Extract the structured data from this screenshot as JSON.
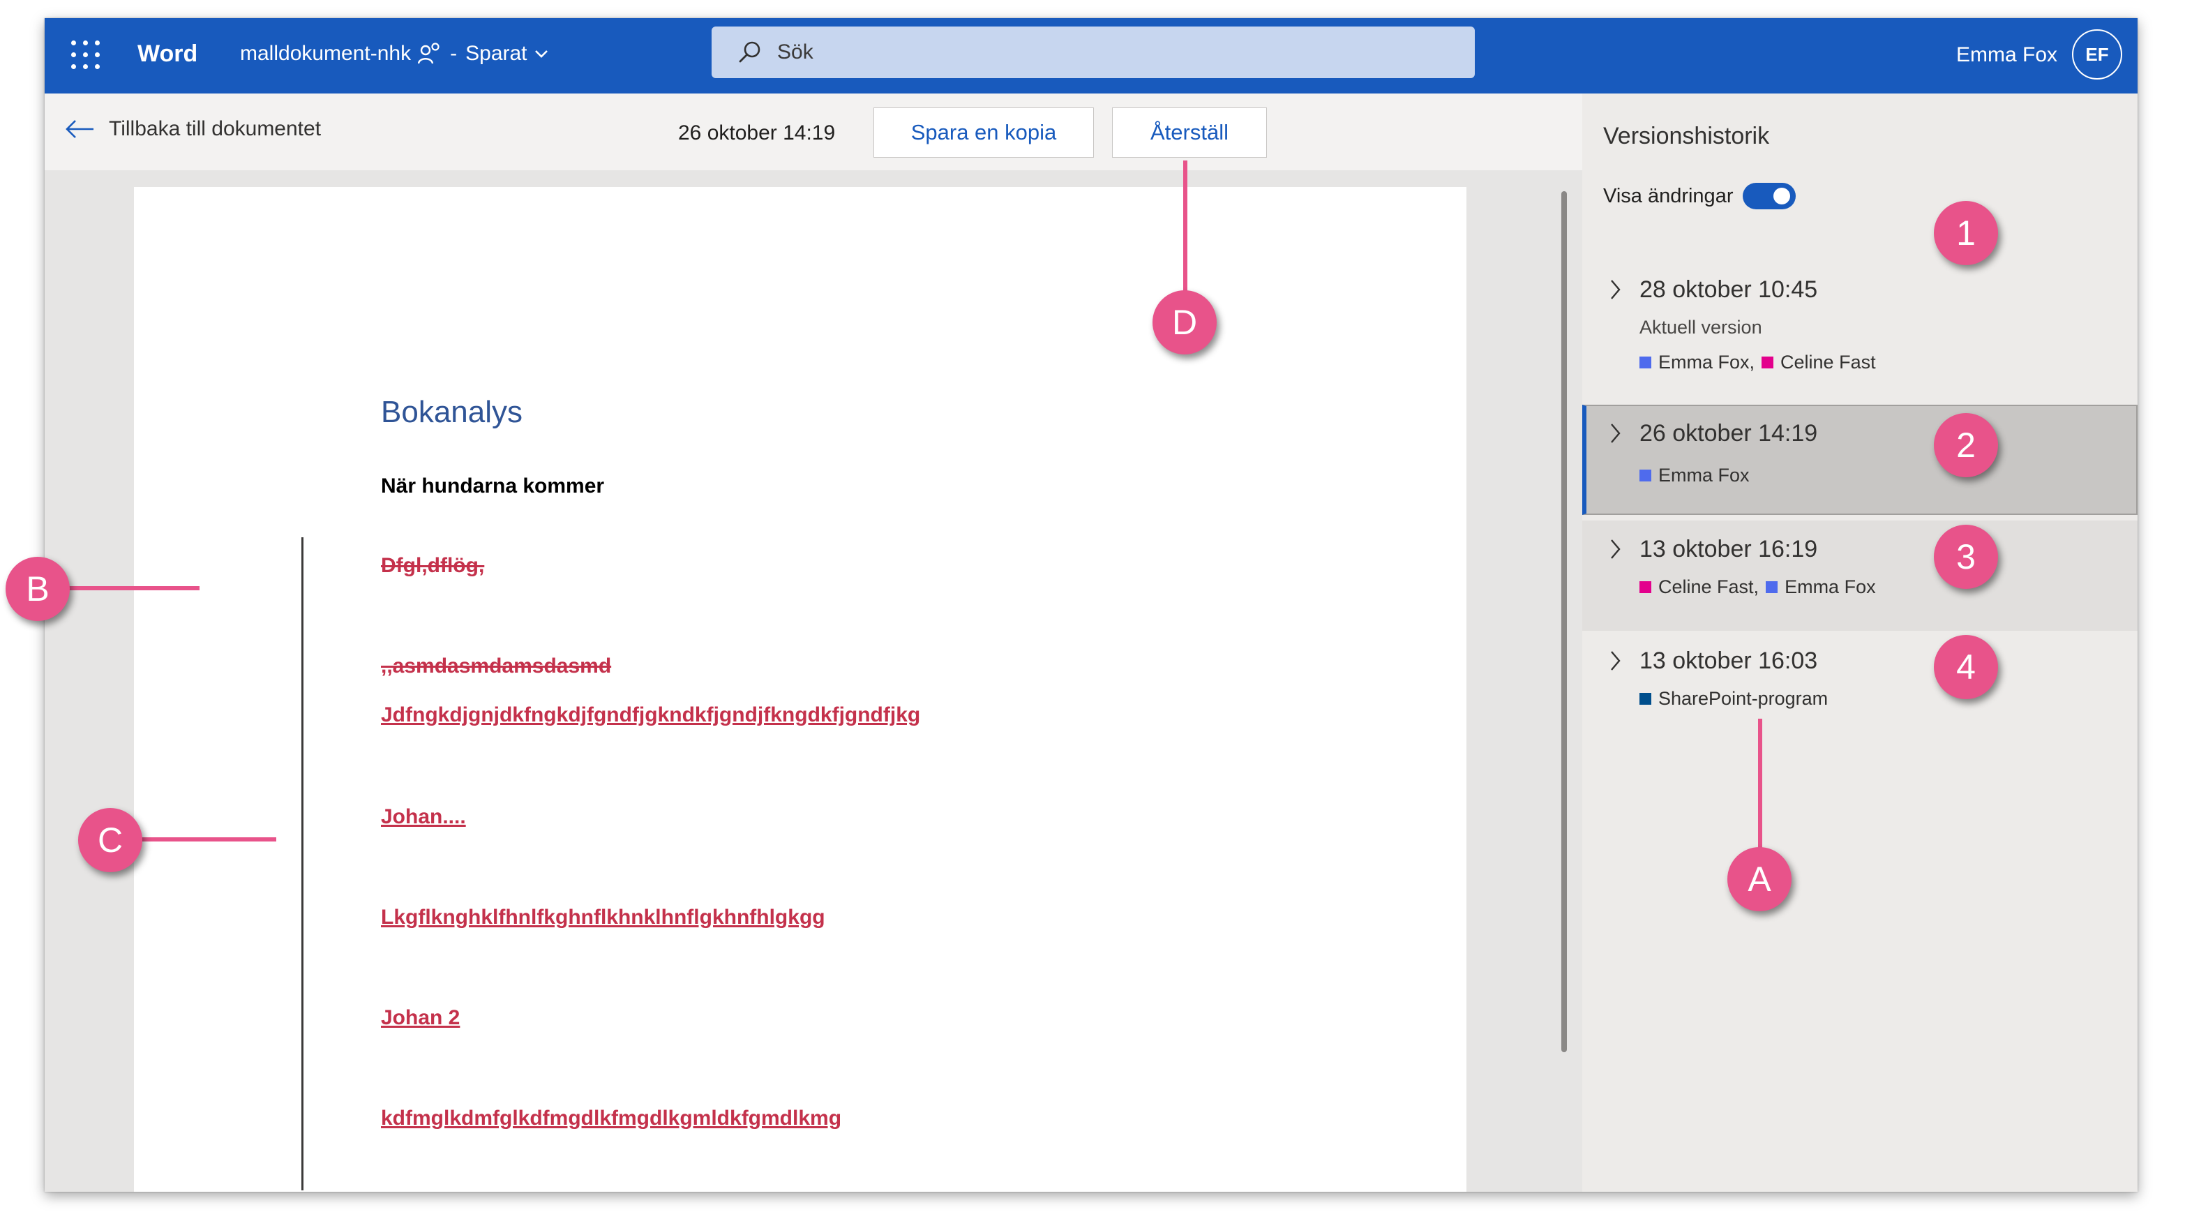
{
  "app": {
    "name": "Word",
    "doc_name": "malldokument-nhk",
    "separator": "-",
    "save_status": "Sparat"
  },
  "search": {
    "placeholder": "Sök"
  },
  "user": {
    "name": "Emma Fox",
    "initials": "EF"
  },
  "toolbar": {
    "back_label": "Tillbaka till dokumentet",
    "version_date": "26 oktober 14:19",
    "save_copy_label": "Spara en kopia",
    "restore_label": "Återställ"
  },
  "document": {
    "title": "Bokanalys",
    "subtitle": "När hundarna kommer",
    "lines": [
      {
        "text": "Dfgl,dflög,",
        "style": "deleted"
      },
      {
        "text": ",,asmdasmdamsdasmd",
        "style": "deleted"
      },
      {
        "text": "Jdfngkdjgnjdkfngkdjfgndfjgkndkfjgndjfkngdkfjgndfjkg",
        "style": "inserted"
      },
      {
        "text": "Johan....",
        "style": "inserted"
      },
      {
        "text": "Lkgflknghklfhnlfkghnflkhnklhnflgkhnfhlgkgg",
        "style": "inserted"
      },
      {
        "text": "Johan 2",
        "style": "inserted"
      },
      {
        "text": "kdfmglkdmfglkdfmgdlkfmgdlkgmldkfgmdlkmg",
        "style": "inserted"
      }
    ]
  },
  "version_panel": {
    "title": "Versionshistorik",
    "toggle_label": "Visa ändringar",
    "toggle_on": true,
    "versions": [
      {
        "date": "28 oktober 10:45",
        "subtitle": "Aktuell version",
        "authors": [
          {
            "name": "Emma Fox,",
            "color": "#4f6bed"
          },
          {
            "name": "Celine Fast",
            "color": "#e3008c"
          }
        ]
      },
      {
        "date": "26 oktober 14:19",
        "selected": true,
        "authors": [
          {
            "name": "Emma Fox",
            "color": "#4f6bed"
          }
        ]
      },
      {
        "date": "13 oktober 16:19",
        "authors": [
          {
            "name": "Celine Fast,",
            "color": "#e3008c"
          },
          {
            "name": "Emma Fox",
            "color": "#4f6bed"
          }
        ]
      },
      {
        "date": "13 oktober 16:03",
        "authors": [
          {
            "name": "SharePoint-program",
            "color": "#004e8c"
          }
        ]
      }
    ]
  },
  "annotations": {
    "one": "1",
    "two": "2",
    "three": "3",
    "four": "4",
    "a": "A",
    "b": "B",
    "c": "C",
    "d": "D"
  },
  "colors": {
    "brand": "#185abd",
    "change": "#c4314b",
    "callout": "#e8538a"
  }
}
